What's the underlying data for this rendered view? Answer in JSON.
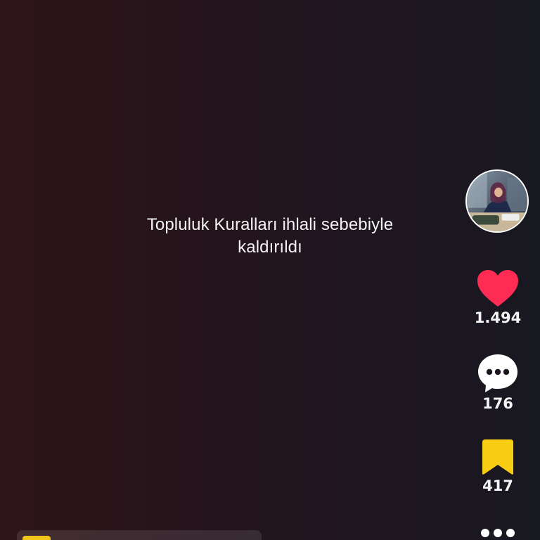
{
  "message": {
    "line1": "Topluluk Kuralları ihlali sebebiyle",
    "line2": "kaldırıldı"
  },
  "sidebar": {
    "avatar_icon": "profile-photo",
    "like": {
      "icon": "heart-icon",
      "count": "1.494",
      "color": "#fe2c55"
    },
    "comment": {
      "icon": "comment-bubble-icon",
      "count": "176",
      "color": "#ffffff"
    },
    "save": {
      "icon": "bookmark-icon",
      "count": "417",
      "color": "#facd15"
    },
    "more": {
      "icon": "more-dots-icon"
    }
  },
  "bottom_bar": {
    "badge_color": "#f0c419"
  }
}
